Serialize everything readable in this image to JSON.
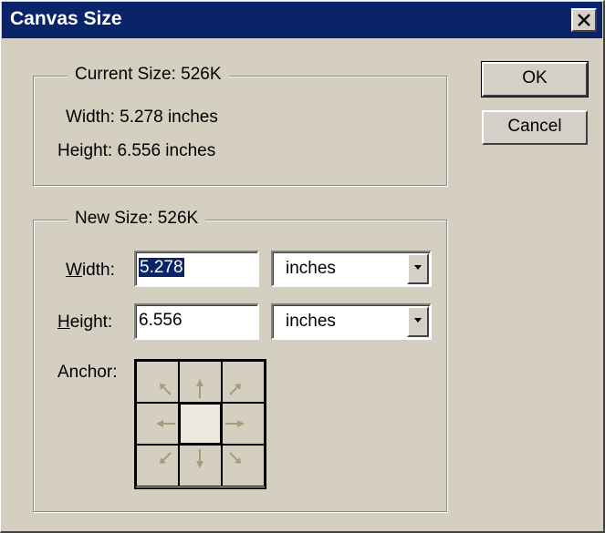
{
  "window": {
    "title": "Canvas Size",
    "close_icon": "close-icon"
  },
  "current_size": {
    "legend": "Current Size:  526K",
    "width_text": "Width: 5.278 inches",
    "height_text": "Height: 6.556 inches"
  },
  "new_size": {
    "legend": "New Size:  526K",
    "width_label_accel": "W",
    "width_label_rest": "idth:",
    "width_value": "5.278",
    "width_unit": "inches",
    "height_label_accel": "H",
    "height_label_rest": "eight:",
    "height_value": "6.556",
    "height_unit": "inches",
    "anchor_label": "Anchor:",
    "anchor_selected": "center",
    "anchor_arrow_color": "#a99a7e"
  },
  "buttons": {
    "ok": "OK",
    "cancel": "Cancel"
  },
  "colors": {
    "titlebar": "#0a246a",
    "dialog_bg": "#d4cfc0",
    "selection": "#0a246a"
  }
}
